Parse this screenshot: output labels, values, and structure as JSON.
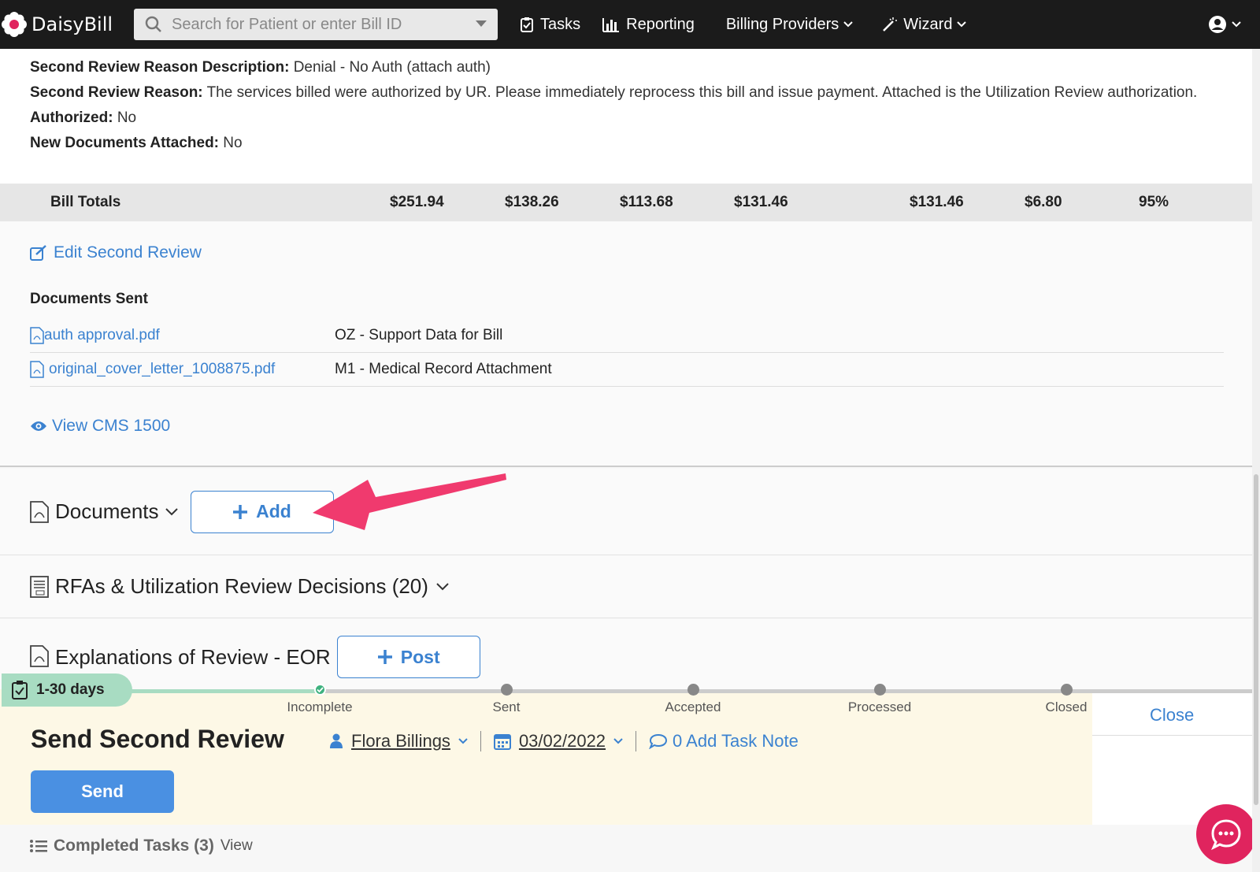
{
  "nav": {
    "brand": "DaisyBill",
    "search_placeholder": "Search for Patient or enter Bill ID",
    "tasks": "Tasks",
    "reporting": "Reporting",
    "billing_providers": "Billing Providers",
    "wizard": "Wizard"
  },
  "detail": {
    "desc_label": "Second Review Reason Description:",
    "desc_value": "Denial - No Auth (attach auth)",
    "reason_label": "Second Review Reason:",
    "reason_value": "The services billed were authorized by UR. Please immediately reprocess this bill and issue payment. Attached is the Utilization Review authorization.",
    "authorized_label": "Authorized:",
    "authorized_value": "No",
    "newdocs_label": "New Documents Attached:",
    "newdocs_value": "No"
  },
  "totals": {
    "label": "Bill Totals",
    "values": [
      "$251.94",
      "$138.26",
      "$113.68",
      "$131.46",
      "$131.46",
      "$6.80",
      "95%"
    ]
  },
  "review": {
    "edit_link": "Edit Second Review",
    "docs_sent_title": "Documents Sent",
    "documents": [
      {
        "file": "auth approval.pdf",
        "type": "OZ - Support Data for Bill"
      },
      {
        "file": "original_cover_letter_1008875.pdf",
        "type": "M1 - Medical Record Attachment"
      }
    ],
    "view_cms": "View CMS 1500"
  },
  "sections": {
    "documents_title": "Documents",
    "add_label": "Add",
    "rfa_title": "RFAs & Utilization Review Decisions (20)",
    "eor_title": "Explanations of Review - EOR",
    "post_label": "Post"
  },
  "task": {
    "days_badge": "1-30 days",
    "steps": [
      "Incomplete",
      "Sent",
      "Accepted",
      "Processed",
      "Closed"
    ],
    "close": "Close",
    "title": "Send Second Review",
    "assignee": "Flora Billings",
    "date": "03/02/2022",
    "note": "0 Add Task Note",
    "send": "Send"
  },
  "completed": {
    "label": "Completed Tasks (3)",
    "view": "View"
  },
  "colors": {
    "link": "#3b82d0",
    "arrow": "#f03a6e",
    "chat": "#e0245e",
    "badge": "#a8dcc2",
    "task_bg": "#fdf8e6"
  }
}
